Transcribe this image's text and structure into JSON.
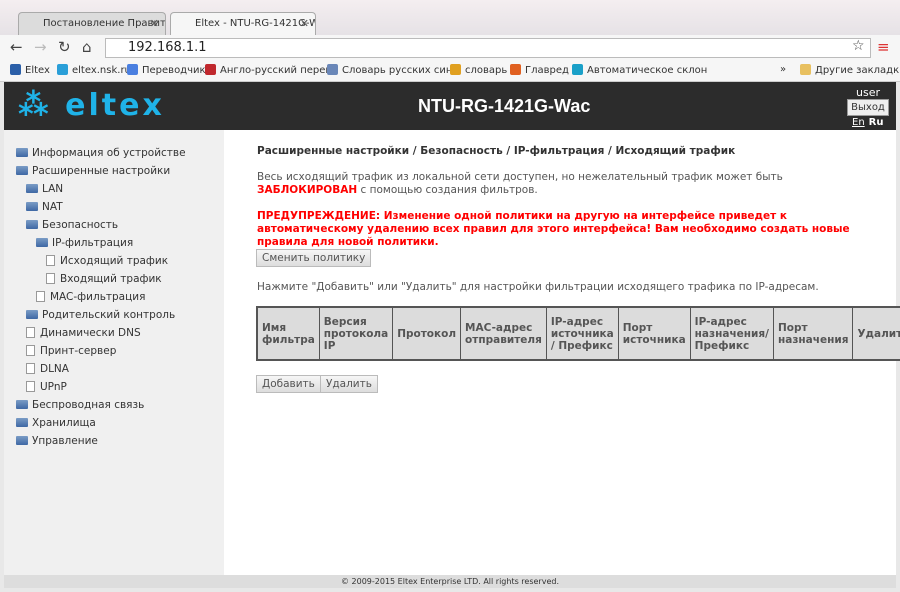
{
  "browser": {
    "tabs": [
      {
        "label": "Постановление Правитель"
      },
      {
        "label": "Eltex - NTU-RG-1421G-Wac"
      }
    ],
    "url": "192.168.1.1",
    "bookmarks": [
      {
        "label": "Eltex",
        "color": "#2b5fa8"
      },
      {
        "label": "eltex.nsk.ru",
        "color": "#2a9fd8"
      },
      {
        "label": "Переводчик",
        "color": "#4a7fe0"
      },
      {
        "label": "Англо-русский перево",
        "color": "#c0282d"
      },
      {
        "label": "Словарь русских сино",
        "color": "#6a87b8"
      },
      {
        "label": "словарь",
        "color": "#e0a020"
      },
      {
        "label": "Главред",
        "color": "#e06020"
      },
      {
        "label": "Автоматическое склон",
        "color": "#1aa0c8"
      }
    ],
    "other_bookmarks": "Другие закладки"
  },
  "header": {
    "logo": "ELTEX",
    "model": "NTU-RG-1421G-Wac",
    "user": "user",
    "logout": "Выход",
    "lang_en": "En",
    "lang_ru": "Ru"
  },
  "sidebar": {
    "items": [
      {
        "label": "Информация об устройстве",
        "level": 0,
        "type": "folder"
      },
      {
        "label": "Расширенные настройки",
        "level": 0,
        "type": "folder"
      },
      {
        "label": "LAN",
        "level": 1,
        "type": "folder"
      },
      {
        "label": "NAT",
        "level": 1,
        "type": "folder"
      },
      {
        "label": "Безопасность",
        "level": 1,
        "type": "folder"
      },
      {
        "label": "IP-фильтрация",
        "level": 2,
        "type": "folder"
      },
      {
        "label": "Исходящий трафик",
        "level": 3,
        "type": "page"
      },
      {
        "label": "Входящий трафик",
        "level": 3,
        "type": "page"
      },
      {
        "label": "MAC-фильтрация",
        "level": 2,
        "type": "page"
      },
      {
        "label": "Родительский контроль",
        "level": 1,
        "type": "folder"
      },
      {
        "label": "Динамически DNS",
        "level": 1,
        "type": "page"
      },
      {
        "label": "Принт-сервер",
        "level": 1,
        "type": "page"
      },
      {
        "label": "DLNA",
        "level": 1,
        "type": "page"
      },
      {
        "label": "UPnP",
        "level": 1,
        "type": "page"
      },
      {
        "label": "Беспроводная связь",
        "level": 0,
        "type": "folder"
      },
      {
        "label": "Хранилища",
        "level": 0,
        "type": "folder"
      },
      {
        "label": "Управление",
        "level": 0,
        "type": "folder"
      }
    ]
  },
  "main": {
    "breadcrumb": "Расширенные настройки / Безопасность / IP-фильтрация / Исходящий трафик",
    "desc_a": "Весь исходящий трафик из локальной сети доступен, но нежелательный трафик может быть ",
    "desc_blocked": "ЗАБЛОКИРОВАН",
    "desc_b": " с помощью создания фильтров.",
    "warning": "ПРЕДУПРЕЖДЕНИЕ: Изменение одной политики на другую на интерфейсе приведет к автоматическому удалению всех правил для этого интерфейса! Вам необходимо создать новые правила для новой политики.",
    "change_policy": "Сменить политику",
    "hint": "Нажмите \"Добавить\" или \"Удалить\" для настройки фильтрации исходящего трафика по IP-адресам.",
    "columns": [
      "Имя фильтра",
      "Версия протокола IP",
      "Протокол",
      "MAC-адрес отправителя",
      "IP-адрес источника / Префикс",
      "Порт источника",
      "IP-адрес назначения/ Префикс",
      "Порт назначения",
      "Удалить"
    ],
    "add": "Добавить",
    "delete": "Удалить"
  },
  "footer": "© 2009-2015 Eltex Enterprise LTD. All rights reserved."
}
